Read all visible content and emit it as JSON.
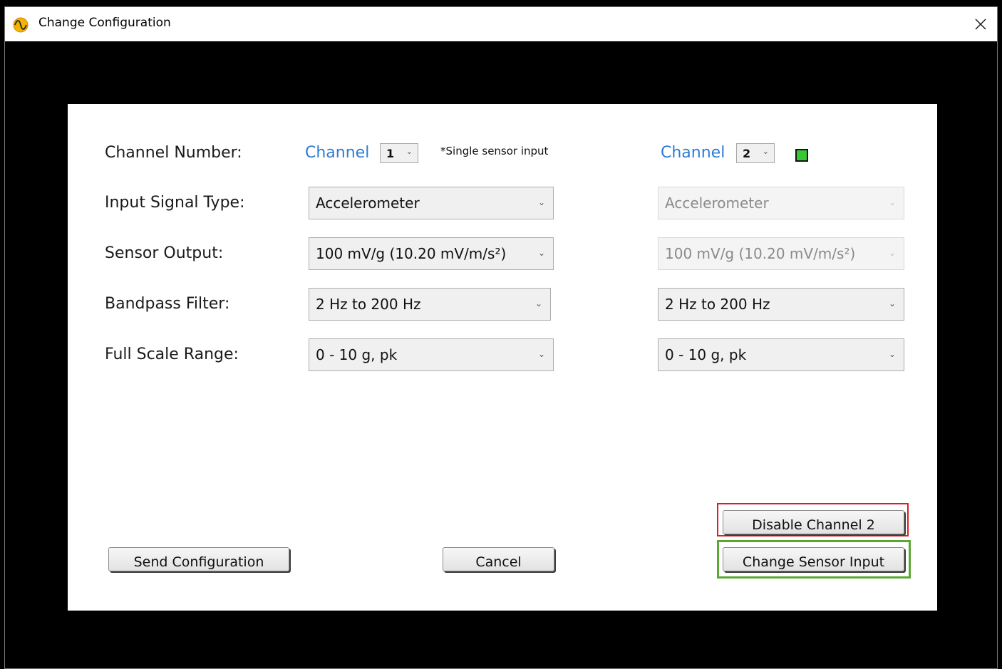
{
  "window": {
    "title": "Change Configuration",
    "close_glyph": "✕"
  },
  "labels": {
    "channel_number": "Channel Number:",
    "input_signal_type": "Input Signal Type:",
    "sensor_output": "Sensor Output:",
    "bandpass_filter": "Bandpass Filter:",
    "full_scale_range": "Full Scale Range:"
  },
  "channel1": {
    "label": "Channel",
    "number": "1",
    "note": "*Single sensor input",
    "input_signal_type": "Accelerometer",
    "sensor_output": "100 mV/g (10.20 mV/m/s²)",
    "bandpass_filter": "2 Hz to 200 Hz",
    "full_scale_range": "0 - 10 g, pk"
  },
  "channel2": {
    "label": "Channel",
    "number": "2",
    "status_color": "#37c837",
    "input_signal_type": "Accelerometer",
    "sensor_output": "100 mV/g (10.20 mV/m/s²)",
    "bandpass_filter": "2 Hz to 200 Hz",
    "full_scale_range": "0 - 10 g, pk"
  },
  "buttons": {
    "send": "Send Configuration",
    "cancel": "Cancel",
    "disable_channel": "Disable Channel 2",
    "change_sensor": "Change Sensor Input"
  },
  "chevron": "⌄",
  "colors": {
    "channel_link": "#2e7bd6",
    "highlight_red": "#d81f26",
    "highlight_green": "#5aa832"
  }
}
